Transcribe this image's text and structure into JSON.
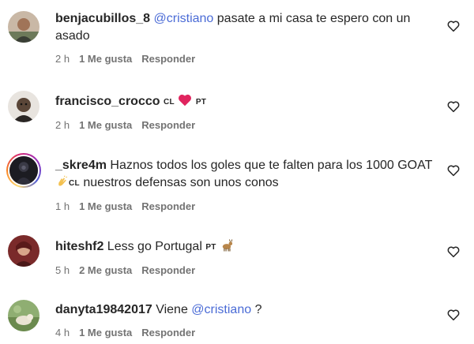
{
  "comments": [
    {
      "username": "benjacubillos_8",
      "mention": "@cristiano",
      "text": " pasate a mi casa te espero con un asado",
      "time": "2 h",
      "likes": "1 Me gusta",
      "reply": "Responder"
    },
    {
      "username": "francisco_crocco",
      "flag1": "CL",
      "flag2": "PT",
      "time": "2 h",
      "likes": "1 Me gusta",
      "reply": "Responder"
    },
    {
      "username": "_skre4m",
      "text_before": "Haznos todos los goles que te falten para los 1000 GOAT ",
      "flag": "CL",
      "text_after": " nuestros defensas son unos conos",
      "time": "1 h",
      "likes": "1 Me gusta",
      "reply": "Responder"
    },
    {
      "username": "hiteshf2",
      "text": "Less go Portugal ",
      "flag": "PT",
      "time": "5 h",
      "likes": "2 Me gusta",
      "reply": "Responder"
    },
    {
      "username": "danyta19842017",
      "text": "Viene ",
      "mention": "@cristiano",
      "text_after": " ?",
      "time": "4 h",
      "likes": "1 Me gusta",
      "reply": "Responder"
    }
  ],
  "icons": {
    "like": "heart-outline-icon",
    "heart_emoji": "red-heart-emoji",
    "clap_emoji": "clapping-hands-emoji",
    "goat_emoji": "goat-emoji"
  },
  "colors": {
    "text": "#262626",
    "secondary": "#737373",
    "mention": "#4a6bd6",
    "heart": "#e0245e"
  }
}
